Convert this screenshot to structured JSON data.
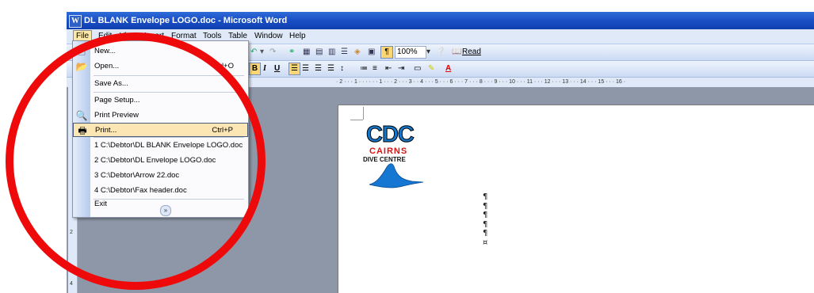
{
  "window": {
    "title": "DL BLANK Envelope LOGO.doc - Microsoft Word"
  },
  "menubar": {
    "items": [
      "File",
      "Edit",
      "View",
      "Insert",
      "Format",
      "Tools",
      "Table",
      "Window",
      "Help"
    ]
  },
  "toolbar": {
    "zoom": "100%",
    "read_label": "Read"
  },
  "file_menu": {
    "items": [
      {
        "label": "New...",
        "shortcut": "",
        "icon": "new-document-icon"
      },
      {
        "label": "Open...",
        "shortcut": "Ctrl+O",
        "icon": "open-folder-icon"
      },
      {
        "label": "Save As...",
        "shortcut": "",
        "icon": ""
      },
      {
        "label": "Page Setup...",
        "shortcut": "",
        "icon": ""
      },
      {
        "label": "Print Preview",
        "shortcut": "",
        "icon": "print-preview-icon"
      },
      {
        "label": "Print...",
        "shortcut": "Ctrl+P",
        "icon": "printer-icon"
      },
      {
        "label": "1 C:\\Debtor\\DL BLANK Envelope LOGO.doc",
        "shortcut": "",
        "icon": ""
      },
      {
        "label": "2 C:\\Debtor\\DL Envelope LOGO.doc",
        "shortcut": "",
        "icon": ""
      },
      {
        "label": "3 C:\\Debtor\\Arrow 22.doc",
        "shortcut": "",
        "icon": ""
      },
      {
        "label": "4 C:\\Debtor\\Fax header.doc",
        "shortcut": "",
        "icon": ""
      },
      {
        "label": "Exit",
        "shortcut": "",
        "icon": ""
      }
    ],
    "highlighted": "Print..."
  },
  "ruler": {
    "text": "· 2 · · · 1 · · ·   · · · 1 · · · 2 · · · 3 ·   · 4 · · · 5 · · · 6 · · · 7 · · · 8 · · · 9 · · · 10 · · · 11 · · · 12 · · · 13 · · · 14 · · · 15 · · · 16 ·"
  },
  "document": {
    "logo": {
      "line1": "CDC",
      "line2": "CAIRNS",
      "line3": "DIVE CENTRE"
    },
    "paragraph_marks": [
      "¶",
      "¶",
      "¶",
      "¶",
      "¶",
      "¤"
    ]
  },
  "annotation": {
    "color": "#ee0a0a"
  },
  "colors": {
    "titlebar": "#1a4fc4",
    "menu_highlight": "#fbe6b4",
    "workspace": "#8d97a7"
  }
}
